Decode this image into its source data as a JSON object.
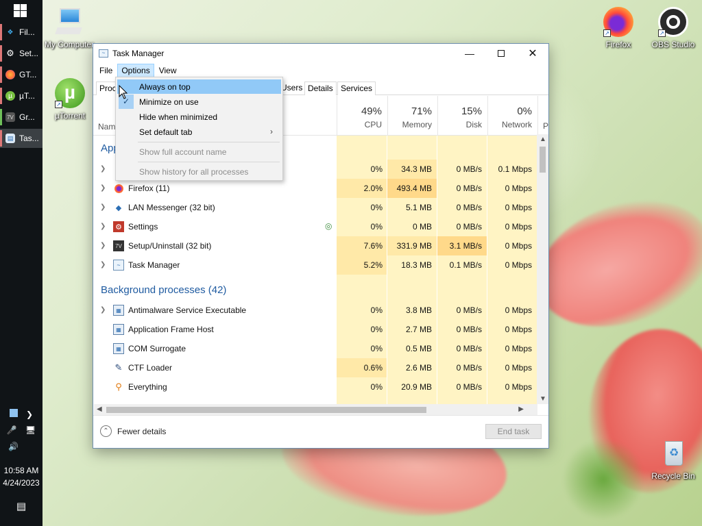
{
  "taskbar": {
    "items": [
      {
        "label": "Fil...",
        "icon": "file-explorer-icon",
        "color": "#3fa9e8"
      },
      {
        "label": "Set...",
        "icon": "gear-icon",
        "color": "#ffffff"
      },
      {
        "label": "GT...",
        "icon": "firefox-icon",
        "color": "#ff7139"
      },
      {
        "label": "µT...",
        "icon": "utorrent-icon",
        "color": "#78c041"
      },
      {
        "label": "Gr...",
        "icon": "setup-icon",
        "color": "#999999"
      },
      {
        "label": "Tas...",
        "icon": "task-manager-icon",
        "color": "#8fb9e0"
      }
    ],
    "time": "10:58 AM",
    "date": "4/24/2023"
  },
  "desktop_icons": [
    {
      "label": "My Computer"
    },
    {
      "label": "µTorrent"
    },
    {
      "label": "Firefox"
    },
    {
      "label": "OBS Studio"
    },
    {
      "label": "Recycle Bin"
    }
  ],
  "window": {
    "title": "Task Manager",
    "menu": [
      "File",
      "Options",
      "View"
    ],
    "tabs": {
      "processes": "Proc",
      "users": "Users",
      "details": "Details",
      "services": "Services"
    },
    "columns": {
      "name": "Nam",
      "cpu": {
        "pct": "49%",
        "label": "CPU"
      },
      "memory": {
        "pct": "71%",
        "label": "Memory"
      },
      "disk": {
        "pct": "15%",
        "label": "Disk"
      },
      "network": {
        "pct": "0%",
        "label": "Network"
      },
      "power": "P"
    },
    "sections": {
      "apps": "App",
      "background": "Background processes (42)"
    },
    "apps": [
      {
        "name": "",
        "cpu": "0%",
        "memory": "34.3 MB",
        "disk": "0 MB/s",
        "network": "0.1 Mbps"
      },
      {
        "name": "Firefox (11)",
        "cpu": "2.0%",
        "memory": "493.4 MB",
        "disk": "0 MB/s",
        "network": "0 Mbps"
      },
      {
        "name": "LAN Messenger (32 bit)",
        "cpu": "0%",
        "memory": "5.1 MB",
        "disk": "0 MB/s",
        "network": "0 Mbps"
      },
      {
        "name": "Settings",
        "cpu": "0%",
        "memory": "0 MB",
        "disk": "0 MB/s",
        "network": "0 Mbps"
      },
      {
        "name": "Setup/Uninstall (32 bit)",
        "cpu": "7.6%",
        "memory": "331.9 MB",
        "disk": "3.1 MB/s",
        "network": "0 Mbps"
      },
      {
        "name": "Task Manager",
        "cpu": "5.2%",
        "memory": "18.3 MB",
        "disk": "0.1 MB/s",
        "network": "0 Mbps"
      }
    ],
    "background": [
      {
        "name": "Antimalware Service Executable",
        "cpu": "0%",
        "memory": "3.8 MB",
        "disk": "0 MB/s",
        "network": "0 Mbps"
      },
      {
        "name": "Application Frame Host",
        "cpu": "0%",
        "memory": "2.7 MB",
        "disk": "0 MB/s",
        "network": "0 Mbps"
      },
      {
        "name": "COM Surrogate",
        "cpu": "0%",
        "memory": "0.5 MB",
        "disk": "0 MB/s",
        "network": "0 Mbps"
      },
      {
        "name": "CTF Loader",
        "cpu": "0.6%",
        "memory": "2.6 MB",
        "disk": "0 MB/s",
        "network": "0 Mbps"
      },
      {
        "name": "Everything",
        "cpu": "0%",
        "memory": "20.9 MB",
        "disk": "0 MB/s",
        "network": "0 Mbps"
      }
    ],
    "footer": {
      "fewer_details": "Fewer details",
      "end_task": "End task"
    }
  },
  "options_menu": {
    "always_on_top": "Always on top",
    "minimize_on_use": "Minimize on use",
    "hide_when_minimized": "Hide when minimized",
    "set_default_tab": "Set default tab",
    "show_full_account_name": "Show full account name",
    "show_history": "Show history for all processes"
  },
  "colors": {
    "heat_light": "#fff4c4",
    "heat_medium": "#ffe9a8",
    "heat_strong": "#ffd98a",
    "accent": "#1e5aa0"
  }
}
